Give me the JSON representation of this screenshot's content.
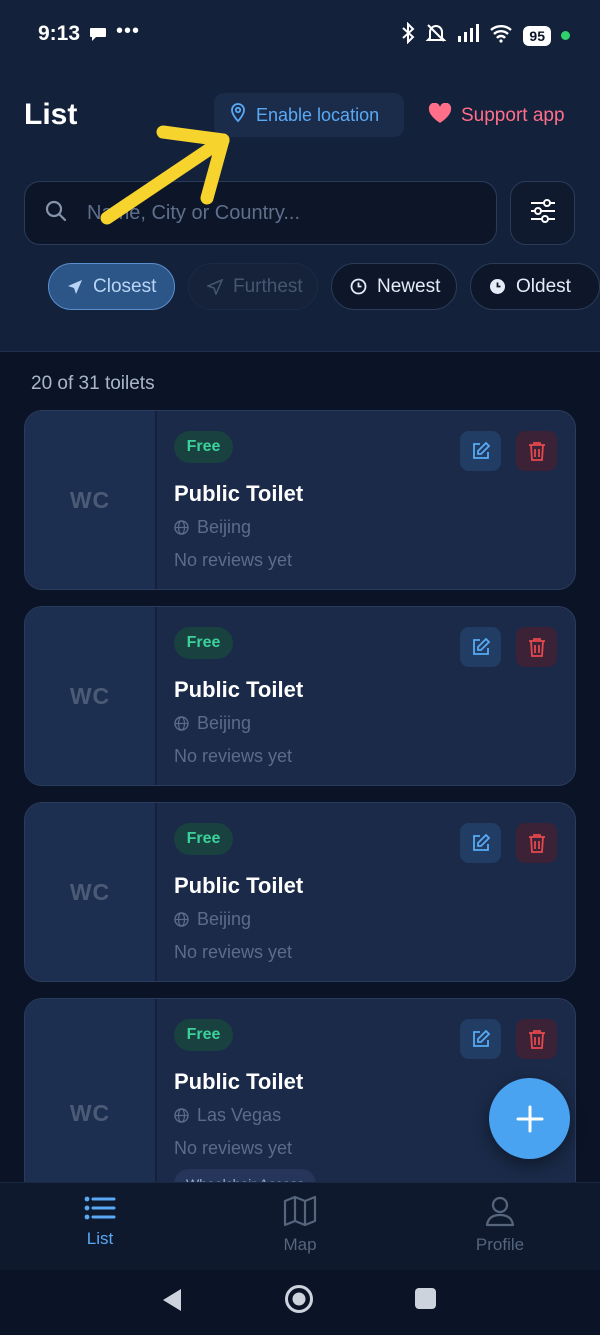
{
  "status_bar": {
    "time": "9:13",
    "dots": "•••",
    "battery": "95"
  },
  "header": {
    "title": "List",
    "enable_location": "Enable location",
    "support": "Support app"
  },
  "search": {
    "placeholder": "Name, City or Country..."
  },
  "sort_chips": [
    {
      "label": "Closest",
      "state": "active",
      "icon": "navigation-arrow-icon"
    },
    {
      "label": "Furthest",
      "state": "disabled",
      "icon": "navigation-arrow-outline-icon"
    },
    {
      "label": "Newest",
      "state": "normal",
      "icon": "clock-icon"
    },
    {
      "label": "Oldest",
      "state": "normal",
      "icon": "clock-filled-icon"
    }
  ],
  "result_count": "20 of 31 toilets",
  "toilets": [
    {
      "thumb": "WC",
      "badge": "Free",
      "title": "Public Toilet",
      "city": "Beijing",
      "reviews": "No reviews yet"
    },
    {
      "thumb": "WC",
      "badge": "Free",
      "title": "Public Toilet",
      "city": "Beijing",
      "reviews": "No reviews yet"
    },
    {
      "thumb": "WC",
      "badge": "Free",
      "title": "Public Toilet",
      "city": "Beijing",
      "reviews": "No reviews yet"
    },
    {
      "thumb": "WC",
      "badge": "Free",
      "title": "Public Toilet",
      "city": "Las Vegas",
      "reviews": "No reviews yet",
      "tag": "Wheelchair Access"
    }
  ],
  "bottom_nav": [
    {
      "label": "List",
      "active": true
    },
    {
      "label": "Map",
      "active": false
    },
    {
      "label": "Profile",
      "active": false
    }
  ],
  "colors": {
    "accent": "#5aa9f5",
    "support": "#ff6f8a",
    "free_badge": "#3ad29a",
    "delete": "#e5484d",
    "fab": "#4aa3f0",
    "annotation_arrow": "#f6d32d"
  }
}
